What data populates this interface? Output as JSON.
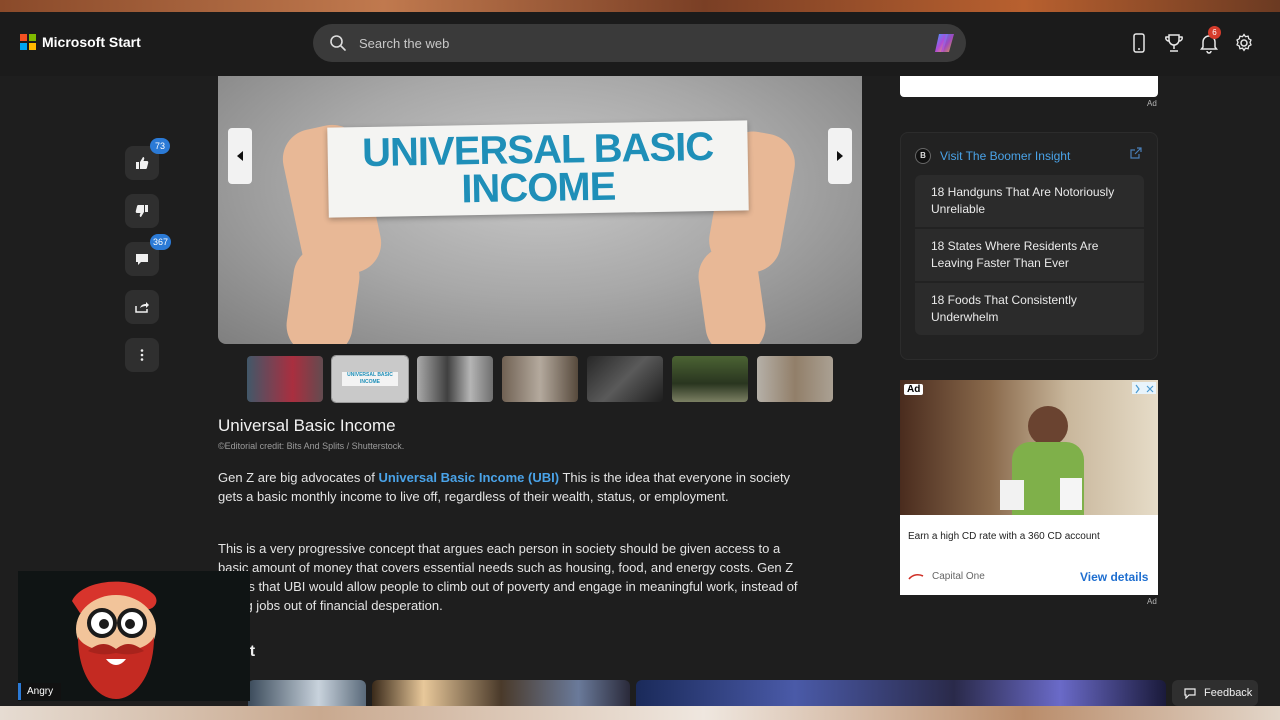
{
  "header": {
    "brand": "Microsoft Start",
    "search_placeholder": "Search the web",
    "notification_count": "6",
    "icons": [
      "phone-icon",
      "trophy-icon",
      "bell-icon",
      "gear-icon"
    ]
  },
  "rail": {
    "likes": "73",
    "comments": "367",
    "icons": [
      "thumbs-up-icon",
      "thumbs-down-icon",
      "comment-icon",
      "share-icon",
      "more-icon"
    ]
  },
  "hero": {
    "sign_line1": "UNIVERSAL BASIC",
    "sign_line2": "INCOME",
    "thumb_caption": "UNIVERSAL BASIC INCOME"
  },
  "article": {
    "title": "Universal Basic Income",
    "credit": "©Editorial credit: Bits And Splits / Shutterstock.",
    "p1_before": "Gen Z are big advocates of ",
    "p1_link": "Universal Basic Income (UBI)",
    "p1_after": " This is the idea that everyone in society gets a basic monthly income to live off, regardless of their wealth, status, or employment.",
    "p2": "This is a very progressive concept that argues each person in society should be given access to a basic amount of money that covers essential needs such as housing, food, and energy costs. Gen Z claims that UBI would allow people to climb out of poverty and engage in meaningful work, instead of taking jobs out of financial desperation.",
    "section_fragment": "nt"
  },
  "right": {
    "ad_label": "Ad",
    "insight_link": "Visit The Boomer Insight",
    "insight_items": [
      "18 Handguns That Are Notoriously Unreliable",
      "18 States Where Residents Are Leaving Faster Than Ever",
      "18 Foods That Consistently Underwhelm"
    ],
    "ad": {
      "tag": "Ad",
      "copy": "Earn a high CD rate with a 360 CD account",
      "brand": "Capital One",
      "cta": "View details"
    }
  },
  "overlay": {
    "cam_label": "Angry",
    "feedback": "Feedback"
  },
  "colors": {
    "accent": "#4aa3e8",
    "badge": "#2b7ad6",
    "sign_text": "#1f8fb8",
    "background": "#1e1e1e"
  }
}
